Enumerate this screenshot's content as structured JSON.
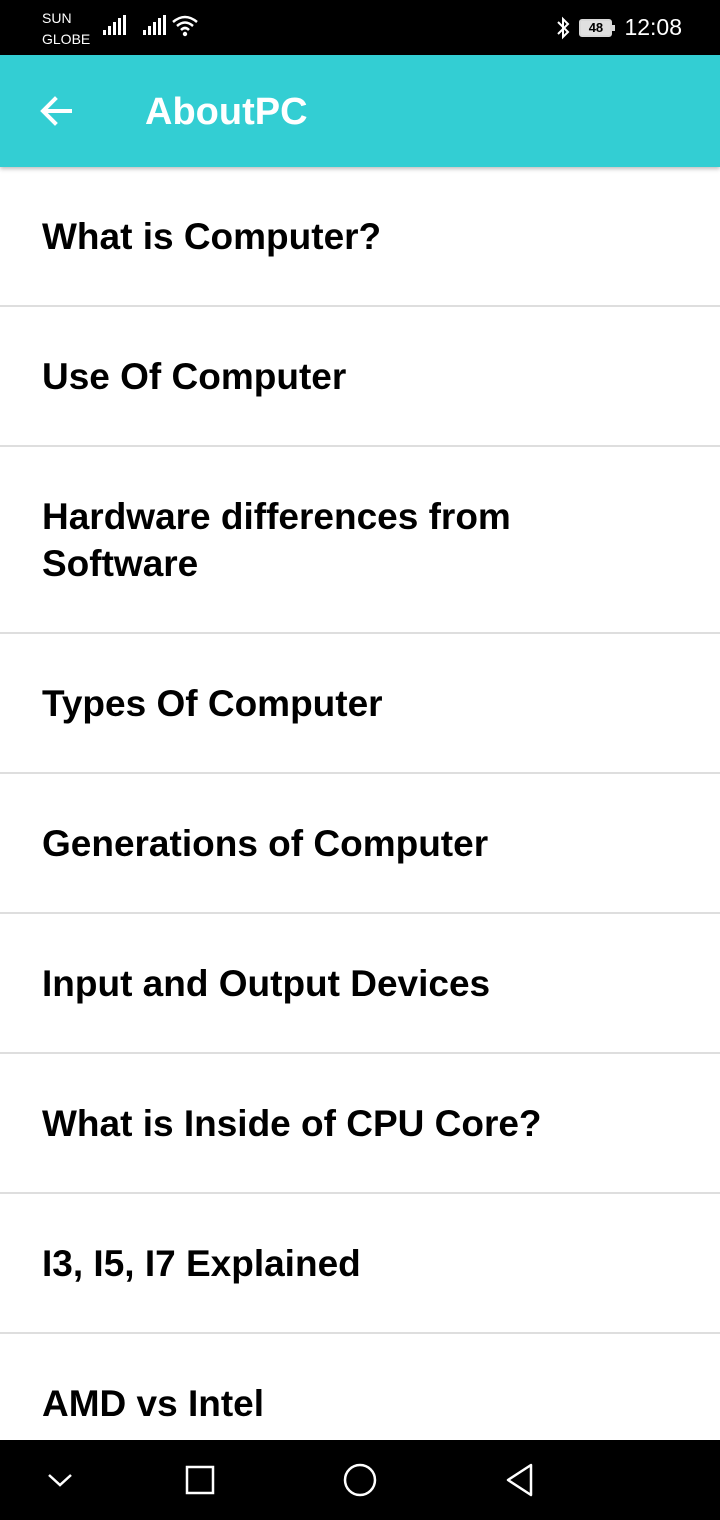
{
  "status_bar": {
    "carrier_line1": "SUN",
    "carrier_line2": "GLOBE",
    "battery_level": "48",
    "time": "12:08",
    "icons": [
      "signal-1-icon",
      "signal-2-icon",
      "wifi-icon",
      "bluetooth-icon",
      "battery-icon"
    ]
  },
  "app_bar": {
    "title": "AboutPC",
    "back_icon": "arrow-left-icon",
    "background_color": "#33ced3"
  },
  "topics": [
    "What is Computer?",
    "Use Of Computer",
    "Hardware differences from Software",
    "Types Of Computer",
    "Generations of Computer",
    "Input and Output Devices",
    "What is Inside of CPU Core?",
    "I3, I5, I7 Explained",
    "AMD vs Intel"
  ],
  "nav_bar": {
    "icons": [
      "chevron-down-icon",
      "square-recents-icon",
      "circle-home-icon",
      "triangle-back-icon"
    ]
  }
}
